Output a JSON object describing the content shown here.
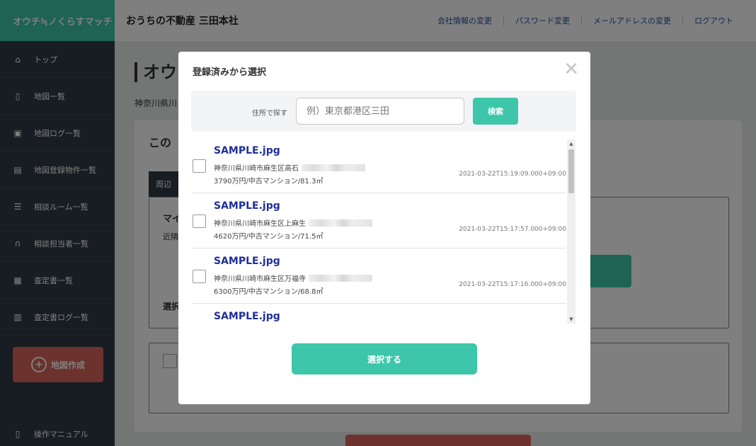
{
  "sidebar": {
    "brand": "オウチ≒ノくらすマッチ",
    "items": [
      {
        "label": "トップ",
        "icon": "home-icon"
      },
      {
        "label": "地図一覧",
        "icon": "map-icon"
      },
      {
        "label": "地図ログ一覧",
        "icon": "chart-icon"
      },
      {
        "label": "地図登録物件一覧",
        "icon": "building-icon"
      },
      {
        "label": "相談ルーム一覧",
        "icon": "chat-room-icon"
      },
      {
        "label": "相談担当者一覧",
        "icon": "headset-icon"
      },
      {
        "label": "査定書一覧",
        "icon": "document-icon"
      },
      {
        "label": "査定書ログ一覧",
        "icon": "document-log-icon"
      }
    ],
    "create_label": "地図作成",
    "manual_label": "操作マニュアル"
  },
  "header": {
    "company": "おうちの不動産 三田本社",
    "links": [
      "会社情報の変更",
      "パスワード変更",
      "メールアドレスの変更",
      "ログアウト"
    ]
  },
  "background": {
    "title_partial": "オウ",
    "subtitle_partial": "神奈川県川",
    "card_title_partial": "この",
    "tab_partial": "周辺",
    "box_text1_partial": "マイ",
    "box_text2_partial": "近隣",
    "box_text3_partial": "選択"
  },
  "modal": {
    "title": "登録済みから選択",
    "search_label": "住所で探す",
    "search_placeholder": "例）東京都港区三田",
    "search_button": "検索",
    "items": [
      {
        "file": "SAMPLE.jpg",
        "address": "神奈川県川崎市麻生区高石",
        "details": "3790万円/中古マンション/81.3㎡",
        "timestamp": "2021-03-22T15:19:09.000+09:00"
      },
      {
        "file": "SAMPLE.jpg",
        "address": "神奈川県川崎市麻生区上麻生",
        "details": "4620万円/中古マンション/71.5㎡",
        "timestamp": "2021-03-22T15:17:57.000+09:00"
      },
      {
        "file": "SAMPLE.jpg",
        "address": "神奈川県川崎市麻生区万福寺",
        "details": "6300万円/中古マンション/68.8㎡",
        "timestamp": "2021-03-22T15:17:16.000+09:00"
      },
      {
        "file": "SAMPLE.jpg"
      }
    ],
    "select_button": "選択する"
  }
}
